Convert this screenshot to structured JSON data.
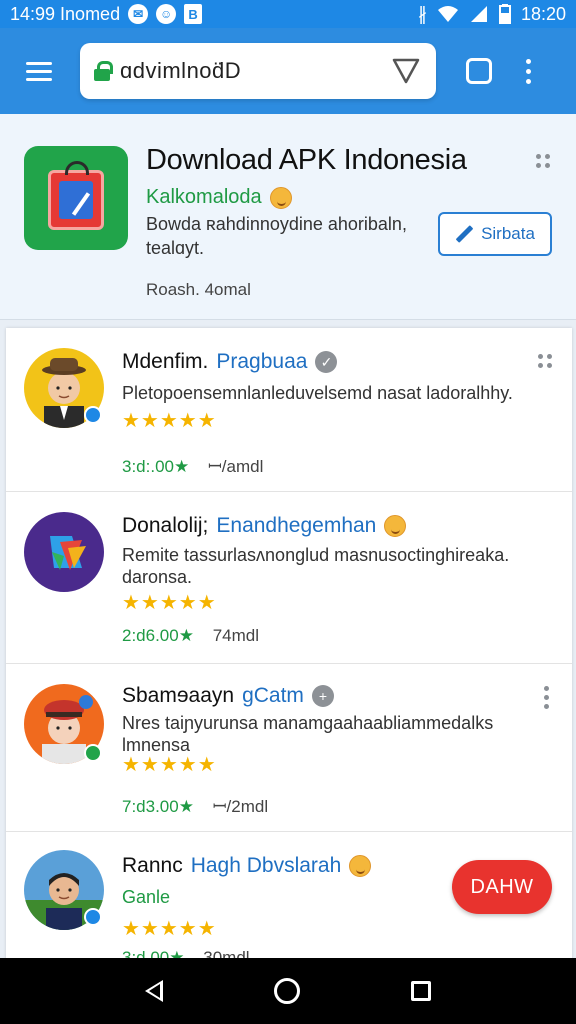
{
  "status_bar": {
    "time_left": "14:99 Inomed",
    "time_right": "18:20",
    "icon_names": [
      "messenger-icon",
      "chat-icon",
      "store-icon",
      "bluetooth-icon",
      "vibrate-icon",
      "wifi-icon",
      "signal-icon",
      "battery-icon"
    ]
  },
  "toolbar": {
    "url": "ɑdvimlnod̈D"
  },
  "app_header": {
    "title": "Download APK Indonesia",
    "developer": "Kalkomaloda",
    "description": "Bowda ʀahdinnoydine ahoribaln, tealɑyt.",
    "meta": "Roash. 4omal",
    "install_label": "Sirbata"
  },
  "items": [
    {
      "name": "Mdenfim.",
      "developer": "Pragbuaa",
      "description": "Pletopoensemnlanleduvelsemd nasat ladoralhhy.",
      "rating": "★★★★★",
      "downloads": "3:d:.00★",
      "size": "ꟷ/amdl"
    },
    {
      "name": "Donalolij;",
      "developer": "Enandhegemhan",
      "description": "Remite tassurlasʌnonglud masnusoctinghireaka. daronsa.",
      "rating": "★★★★★",
      "downloads": "2:d6.00★",
      "size": "74mdl"
    },
    {
      "name": "Sbamɘaayn",
      "developer": "gCatm",
      "description": "Nres taiɲyurunsa manamgaahaabliammedalks lmnensa",
      "rating": "★★★★★",
      "downloads": "7:d3.00★",
      "size": "ꟷ/2mdl"
    },
    {
      "name": "Rannc",
      "developer": "Hagh Dbvslarah",
      "description": "Ganle",
      "rating": "★★★★★",
      "downloads": "3:d.00★",
      "size": "30mdl",
      "action_label": "DAHW"
    }
  ],
  "colors": {
    "primary": "#2d8ce0",
    "accent_green": "#1f9a44",
    "accent_blue": "#1f6fc2",
    "star": "#f5b400",
    "open_button": "#e8332e"
  }
}
